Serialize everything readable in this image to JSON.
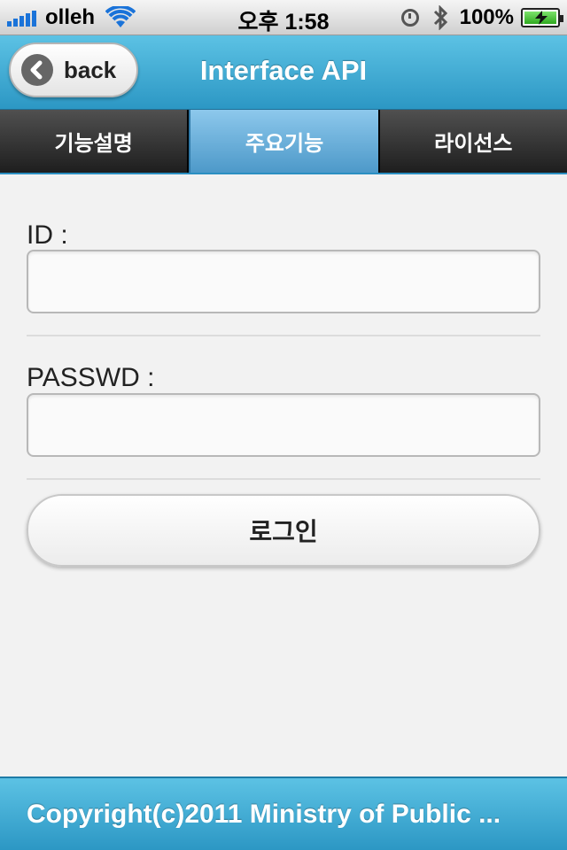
{
  "status_bar": {
    "carrier": "olleh",
    "time": "오후 1:58",
    "battery_percent": "100%",
    "battery_level": 1.0,
    "icons": [
      "signal-icon",
      "wifi-icon",
      "clock-icon",
      "bluetooth-icon",
      "battery-icon"
    ]
  },
  "header": {
    "back_label": "back",
    "title": "Interface API"
  },
  "tabs": [
    {
      "label": "기능설명",
      "active": false
    },
    {
      "label": "주요기능",
      "active": true
    },
    {
      "label": "라이선스",
      "active": false
    }
  ],
  "form": {
    "id_label": "ID :",
    "id_value": "",
    "passwd_label": "PASSWD :",
    "passwd_value": "",
    "login_label": "로그인"
  },
  "footer": {
    "text": "Copyright(c)2011 Ministry of Public ..."
  },
  "colors": {
    "accent": "#2c97c4",
    "tab_active": "#4d99c9",
    "tab_inactive": "#1e1e1e"
  }
}
